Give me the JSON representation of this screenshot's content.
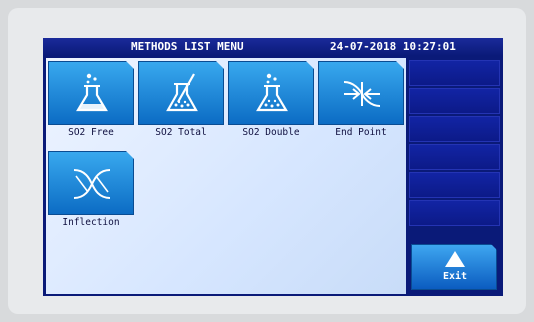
{
  "header": {
    "title": "METHODS LIST MENU",
    "datetime": "24-07-2018 10:27:01"
  },
  "methods": [
    {
      "label": "SO2 Free",
      "icon": "flask-bubbles-icon"
    },
    {
      "label": "SO2 Total",
      "icon": "flask-stirrer-icon"
    },
    {
      "label": "SO2 Double",
      "icon": "flask-bubbles-icon"
    },
    {
      "label": "End Point",
      "icon": "end-point-arrows-icon"
    },
    {
      "label": "Inflection",
      "icon": "inflection-curves-icon"
    }
  ],
  "side": {
    "exit_label": "Exit",
    "exit_icon": "up-arrow-icon"
  }
}
